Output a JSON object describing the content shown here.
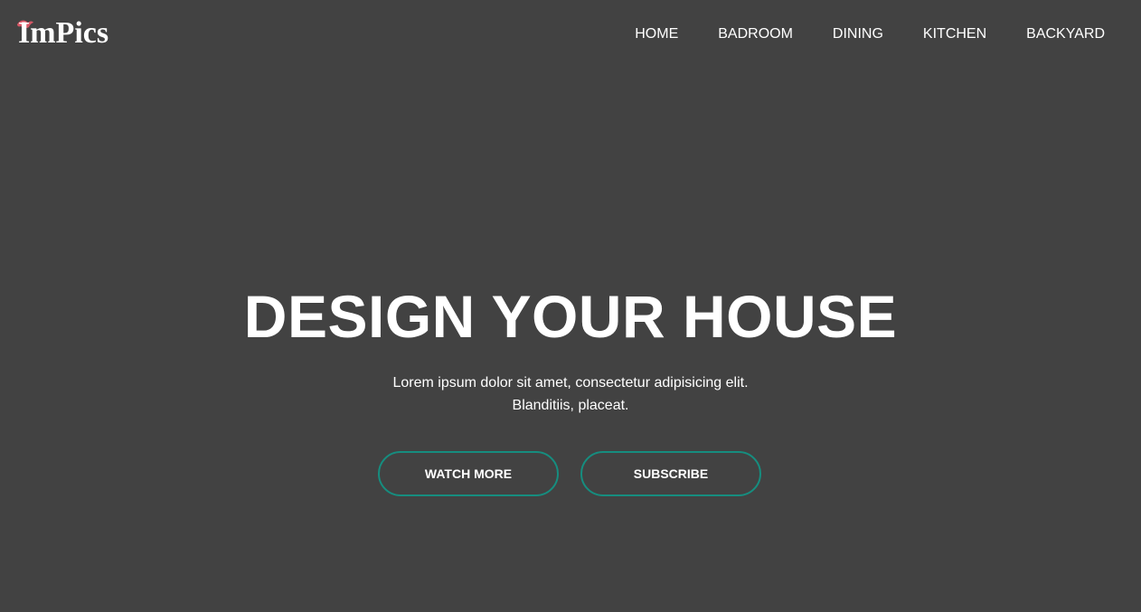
{
  "brand": {
    "logo_text": "ImPics",
    "accent_color": "#e85a6a"
  },
  "nav": {
    "items": [
      {
        "label": "HOME"
      },
      {
        "label": "BADROOM"
      },
      {
        "label": "DINING"
      },
      {
        "label": "KITCHEN"
      },
      {
        "label": "BACKYARD"
      }
    ]
  },
  "hero": {
    "title": "DESIGN YOUR HOUSE",
    "subtitle_line1": "Lorem ipsum dolor sit amet, consectetur adipisicing elit.",
    "subtitle_line2": "Blanditiis, placeat.",
    "buttons": {
      "watch_more": "WATCH MORE",
      "subscribe": "SUBSCRIBE"
    },
    "button_border_color": "#168d7f"
  },
  "colors": {
    "background": "#424242",
    "text": "#ffffff"
  }
}
